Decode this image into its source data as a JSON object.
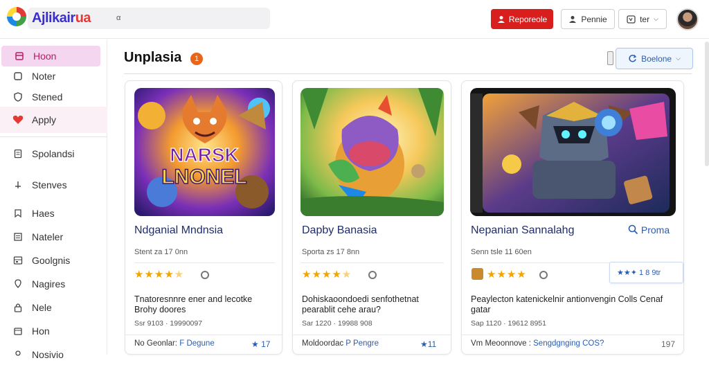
{
  "header": {
    "brand_main": "Ajlikair",
    "brand_tail": "ua",
    "search_hint": "α",
    "primary_button": "Reporeole",
    "profile_button": "Pennie",
    "lang_button": "ter"
  },
  "sidebar": {
    "items": [
      {
        "label": "Hoon",
        "icon": "bookmark-icon",
        "state": "active"
      },
      {
        "label": "Noter",
        "icon": "note-icon",
        "state": "normal"
      },
      {
        "label": "Stened",
        "icon": "shield-icon",
        "state": "normal"
      },
      {
        "label": "Apply",
        "icon": "heart-icon",
        "state": "highlight"
      },
      {
        "label": "Spolandsi",
        "icon": "document-icon",
        "state": "normal"
      },
      {
        "label": "Stenves",
        "icon": "plus-icon",
        "state": "normal"
      },
      {
        "label": "Haes",
        "icon": "tag-icon",
        "state": "normal"
      },
      {
        "label": "Nateler",
        "icon": "list-icon",
        "state": "normal"
      },
      {
        "label": "Goolgnis",
        "icon": "grid-icon",
        "state": "normal"
      },
      {
        "label": "Nagires",
        "icon": "pin-icon",
        "state": "normal"
      },
      {
        "label": "Nele",
        "icon": "lock-icon",
        "state": "normal"
      },
      {
        "label": "Hon",
        "icon": "box-icon",
        "state": "normal"
      },
      {
        "label": "Nosivio",
        "icon": "user-icon",
        "state": "normal"
      }
    ]
  },
  "main": {
    "title": "Unplasia",
    "badge": "1",
    "filter_button": "Boelone"
  },
  "cards": [
    {
      "art_caption_line1": "NARSK",
      "art_caption_line2": "LNONEL",
      "title": "Ndganial Mndnsia",
      "meta": "Stent za   17 0nn",
      "rating": 4.5,
      "desc": "Tnatoresnnre ener and lecotke Brohy doores",
      "sub": "Ssr 9103  · 19990097",
      "foot_label": "No Geonlar:",
      "foot_link": "F Degune",
      "foot_rating": "17"
    },
    {
      "title": "Dapby Banasia",
      "meta": "Sporta zs   17 8nn",
      "rating": 4.5,
      "desc": "Dohiskaoondoedi senfothetnat pearablit cehe arau?",
      "sub": "Sar 1220  · 19988 908",
      "foot_label": "Moldoordac",
      "foot_link": "P Pengre",
      "foot_rating": "11"
    },
    {
      "title": "Nepanian Sannalahg",
      "action": "Proma",
      "meta": "Senn tsle   11 60en",
      "rating": 4,
      "desc": "Peaylecton katenickelnir antionvengin Colls Cenaf gatar",
      "sub": "Sap 1120  · 19612 8951",
      "foot_label": "Vm Meoonnove :",
      "foot_link": "Sengdgnging COS?",
      "foot_rating": "197",
      "rating_box": "★★✦ 1 8 9tr"
    }
  ],
  "colors": {
    "primary_red": "#d91e1e",
    "active_sidebar": "#f4d6f1",
    "link_blue": "#2a5db0",
    "star": "#f4a400",
    "badge": "#e8651a"
  }
}
